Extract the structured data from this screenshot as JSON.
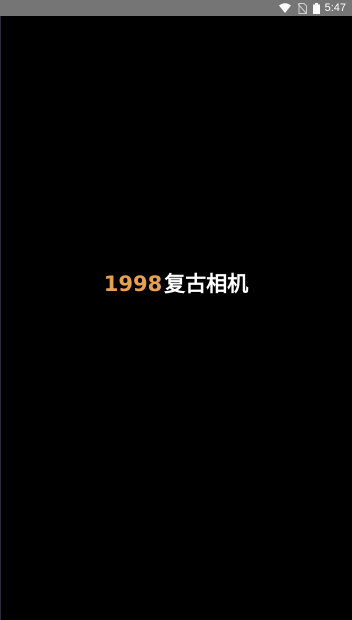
{
  "status_bar": {
    "time": "5:47",
    "icons": [
      "wifi-icon",
      "no-sim-icon",
      "battery-icon"
    ]
  },
  "splash": {
    "year": "1998",
    "app_name": "复古相机"
  },
  "colors": {
    "background": "#000000",
    "status_bar": "#757575",
    "accent": "#e6a052",
    "title_text": "#ffffff"
  }
}
